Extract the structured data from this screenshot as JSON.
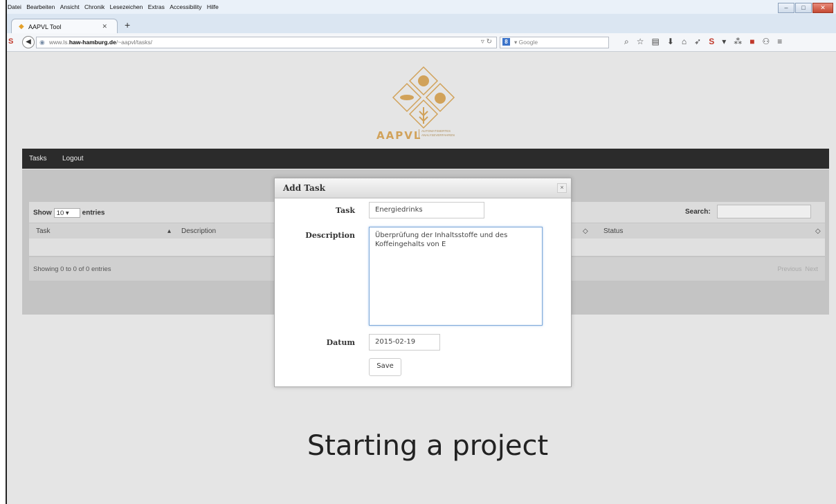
{
  "browser": {
    "menu": [
      "Datei",
      "Bearbeiten",
      "Ansicht",
      "Chronik",
      "Lesezeichen",
      "Extras",
      "Accessibility",
      "Hilfe"
    ],
    "tab_title": "AAPVL Tool",
    "url_prefix": "www.ls.",
    "url_host": "haw-hamburg.de",
    "url_path": "/~aapvl/tasks/",
    "search_placeholder": "Google"
  },
  "logo": {
    "name": "AAPVL",
    "subtitle": "AUTOMATISIERTES ANALYSEVERFAHREN",
    "colors": {
      "gold": "#d1a25a"
    }
  },
  "nav": {
    "items": [
      "Tasks",
      "Logout"
    ]
  },
  "table": {
    "show_label": "Show",
    "entries_value": "10",
    "entries_label": "entries",
    "search_label": "Search:",
    "columns": [
      "Task",
      "Description",
      "Status"
    ],
    "info": "Showing 0 to 0 of 0 entries",
    "prev": "Previous",
    "next": "Next"
  },
  "modal": {
    "title": "Add Task",
    "close": "×",
    "task_label": "Task",
    "task_value": "Energiedrinks",
    "description_label": "Description",
    "description_value": "Überprüfung der Inhaltsstoffe und des Koffeingehalts von E",
    "datum_label": "Datum",
    "datum_value": "2015-02-19",
    "save_label": "Save"
  },
  "caption": "Starting a project"
}
